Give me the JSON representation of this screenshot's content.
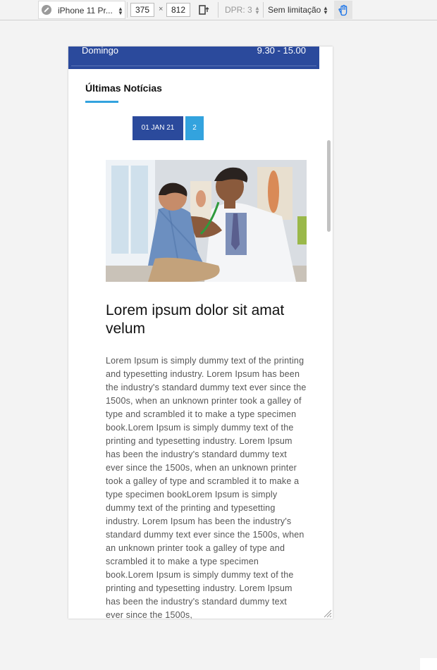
{
  "toolbar": {
    "device": "iPhone 11 Pr...",
    "width": "375",
    "height": "812",
    "times": "×",
    "dpr": "DPR: 3",
    "throttling": "Sem limitação"
  },
  "schedule": {
    "day": "Domingo",
    "hours": "9.30 - 15.00"
  },
  "news": {
    "heading": "Últimas Notícias",
    "pager_date": "01 JAN 21",
    "pager_page": "2",
    "article_title": "Lorem ipsum dolor sit amat velum",
    "article_body": "Lorem Ipsum is simply dummy text of the printing and typesetting industry. Lorem Ipsum has been the industry's standard dummy text ever since the 1500s, when an unknown printer took a galley of type and scrambled it to make a type specimen book.Lorem Ipsum is simply dummy text of the printing and typesetting industry. Lorem Ipsum has been the industry's standard dummy text ever since the 1500s, when an unknown printer took a galley of type and scrambled it to make a type specimen bookLorem Ipsum is simply dummy text of the printing and typesetting industry. Lorem Ipsum has been the industry's standard dummy text ever since the 1500s, when an unknown printer took a galley of type and scrambled it to make a type specimen book.Lorem Ipsum is simply dummy text of the printing and typesetting industry. Lorem Ipsum has been the industry's standard dummy text ever since the 1500s,"
  },
  "colors": {
    "brand_blue": "#2b4a9c",
    "accent_blue": "#33a3de"
  }
}
